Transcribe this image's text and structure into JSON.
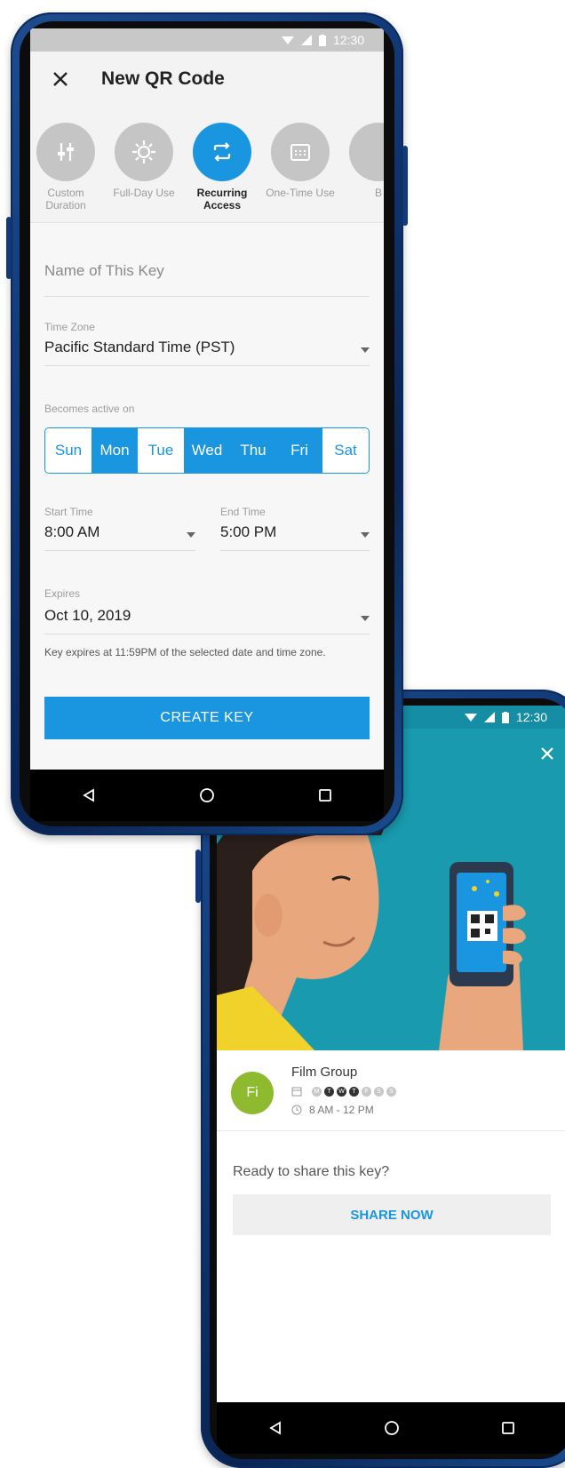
{
  "phone1": {
    "status_time": "12:30",
    "title": "New QR Code",
    "types": [
      {
        "label": "Custom Duration",
        "icon": "sliders-icon"
      },
      {
        "label": "Full-Day Use",
        "icon": "sun-icon"
      },
      {
        "label": "Recurring Access",
        "icon": "repeat-icon"
      },
      {
        "label": "One-Time Use",
        "icon": "calendar-icon"
      },
      {
        "label": "B",
        "icon": "circle-icon"
      }
    ],
    "name_placeholder": "Name of This Key",
    "timezone_label": "Time Zone",
    "timezone_value": "Pacific Standard Time (PST)",
    "active_label": "Becomes active on",
    "days": [
      "Sun",
      "Mon",
      "Tue",
      "Wed",
      "Thu",
      "Fri",
      "Sat"
    ],
    "start_label": "Start Time",
    "start_value": "8:00 AM",
    "end_label": "End Time",
    "end_value": "5:00 PM",
    "expires_label": "Expires",
    "expires_value": "Oct 10, 2019",
    "hint": "Key expires at 11:59PM of the selected date and time zone.",
    "create_button": "CREATE KEY"
  },
  "phone2": {
    "status_time": "12:30",
    "avatar": "Fi",
    "group_name": "Film Group",
    "day_letters": [
      "M",
      "T",
      "W",
      "T",
      "F",
      "S",
      "S"
    ],
    "time_range": "8 AM - 12 PM",
    "ready_text": "Ready to share this key?",
    "share_button": "SHARE NOW"
  },
  "colors": {
    "accent": "#1a95e0",
    "illustration_bg": "#199aae",
    "avatar": "#8dba2e",
    "phone_frame": "#123876"
  }
}
